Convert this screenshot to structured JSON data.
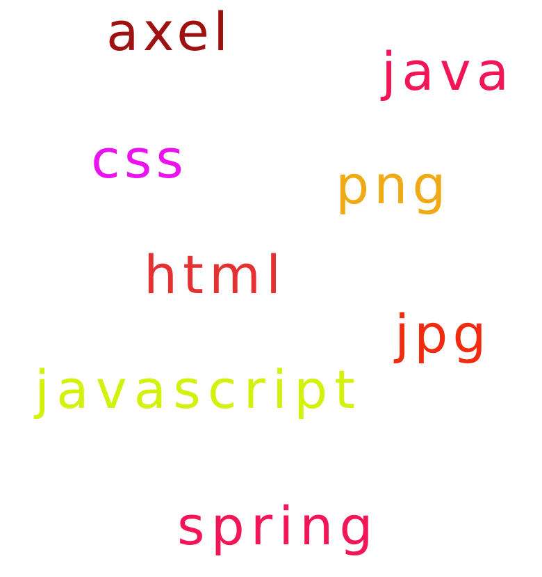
{
  "words": [
    {
      "text": "axel",
      "color": "#9E1111"
    },
    {
      "text": "java",
      "color": "#F21558"
    },
    {
      "text": "css",
      "color": "#EB12F0"
    },
    {
      "text": "png",
      "color": "#EFAA16"
    },
    {
      "text": "html",
      "color": "#E43232"
    },
    {
      "text": "jpg",
      "color": "#F02B10"
    },
    {
      "text": "javascript",
      "color": "#D2F20D"
    },
    {
      "text": "spring",
      "color": "#F21558"
    }
  ]
}
